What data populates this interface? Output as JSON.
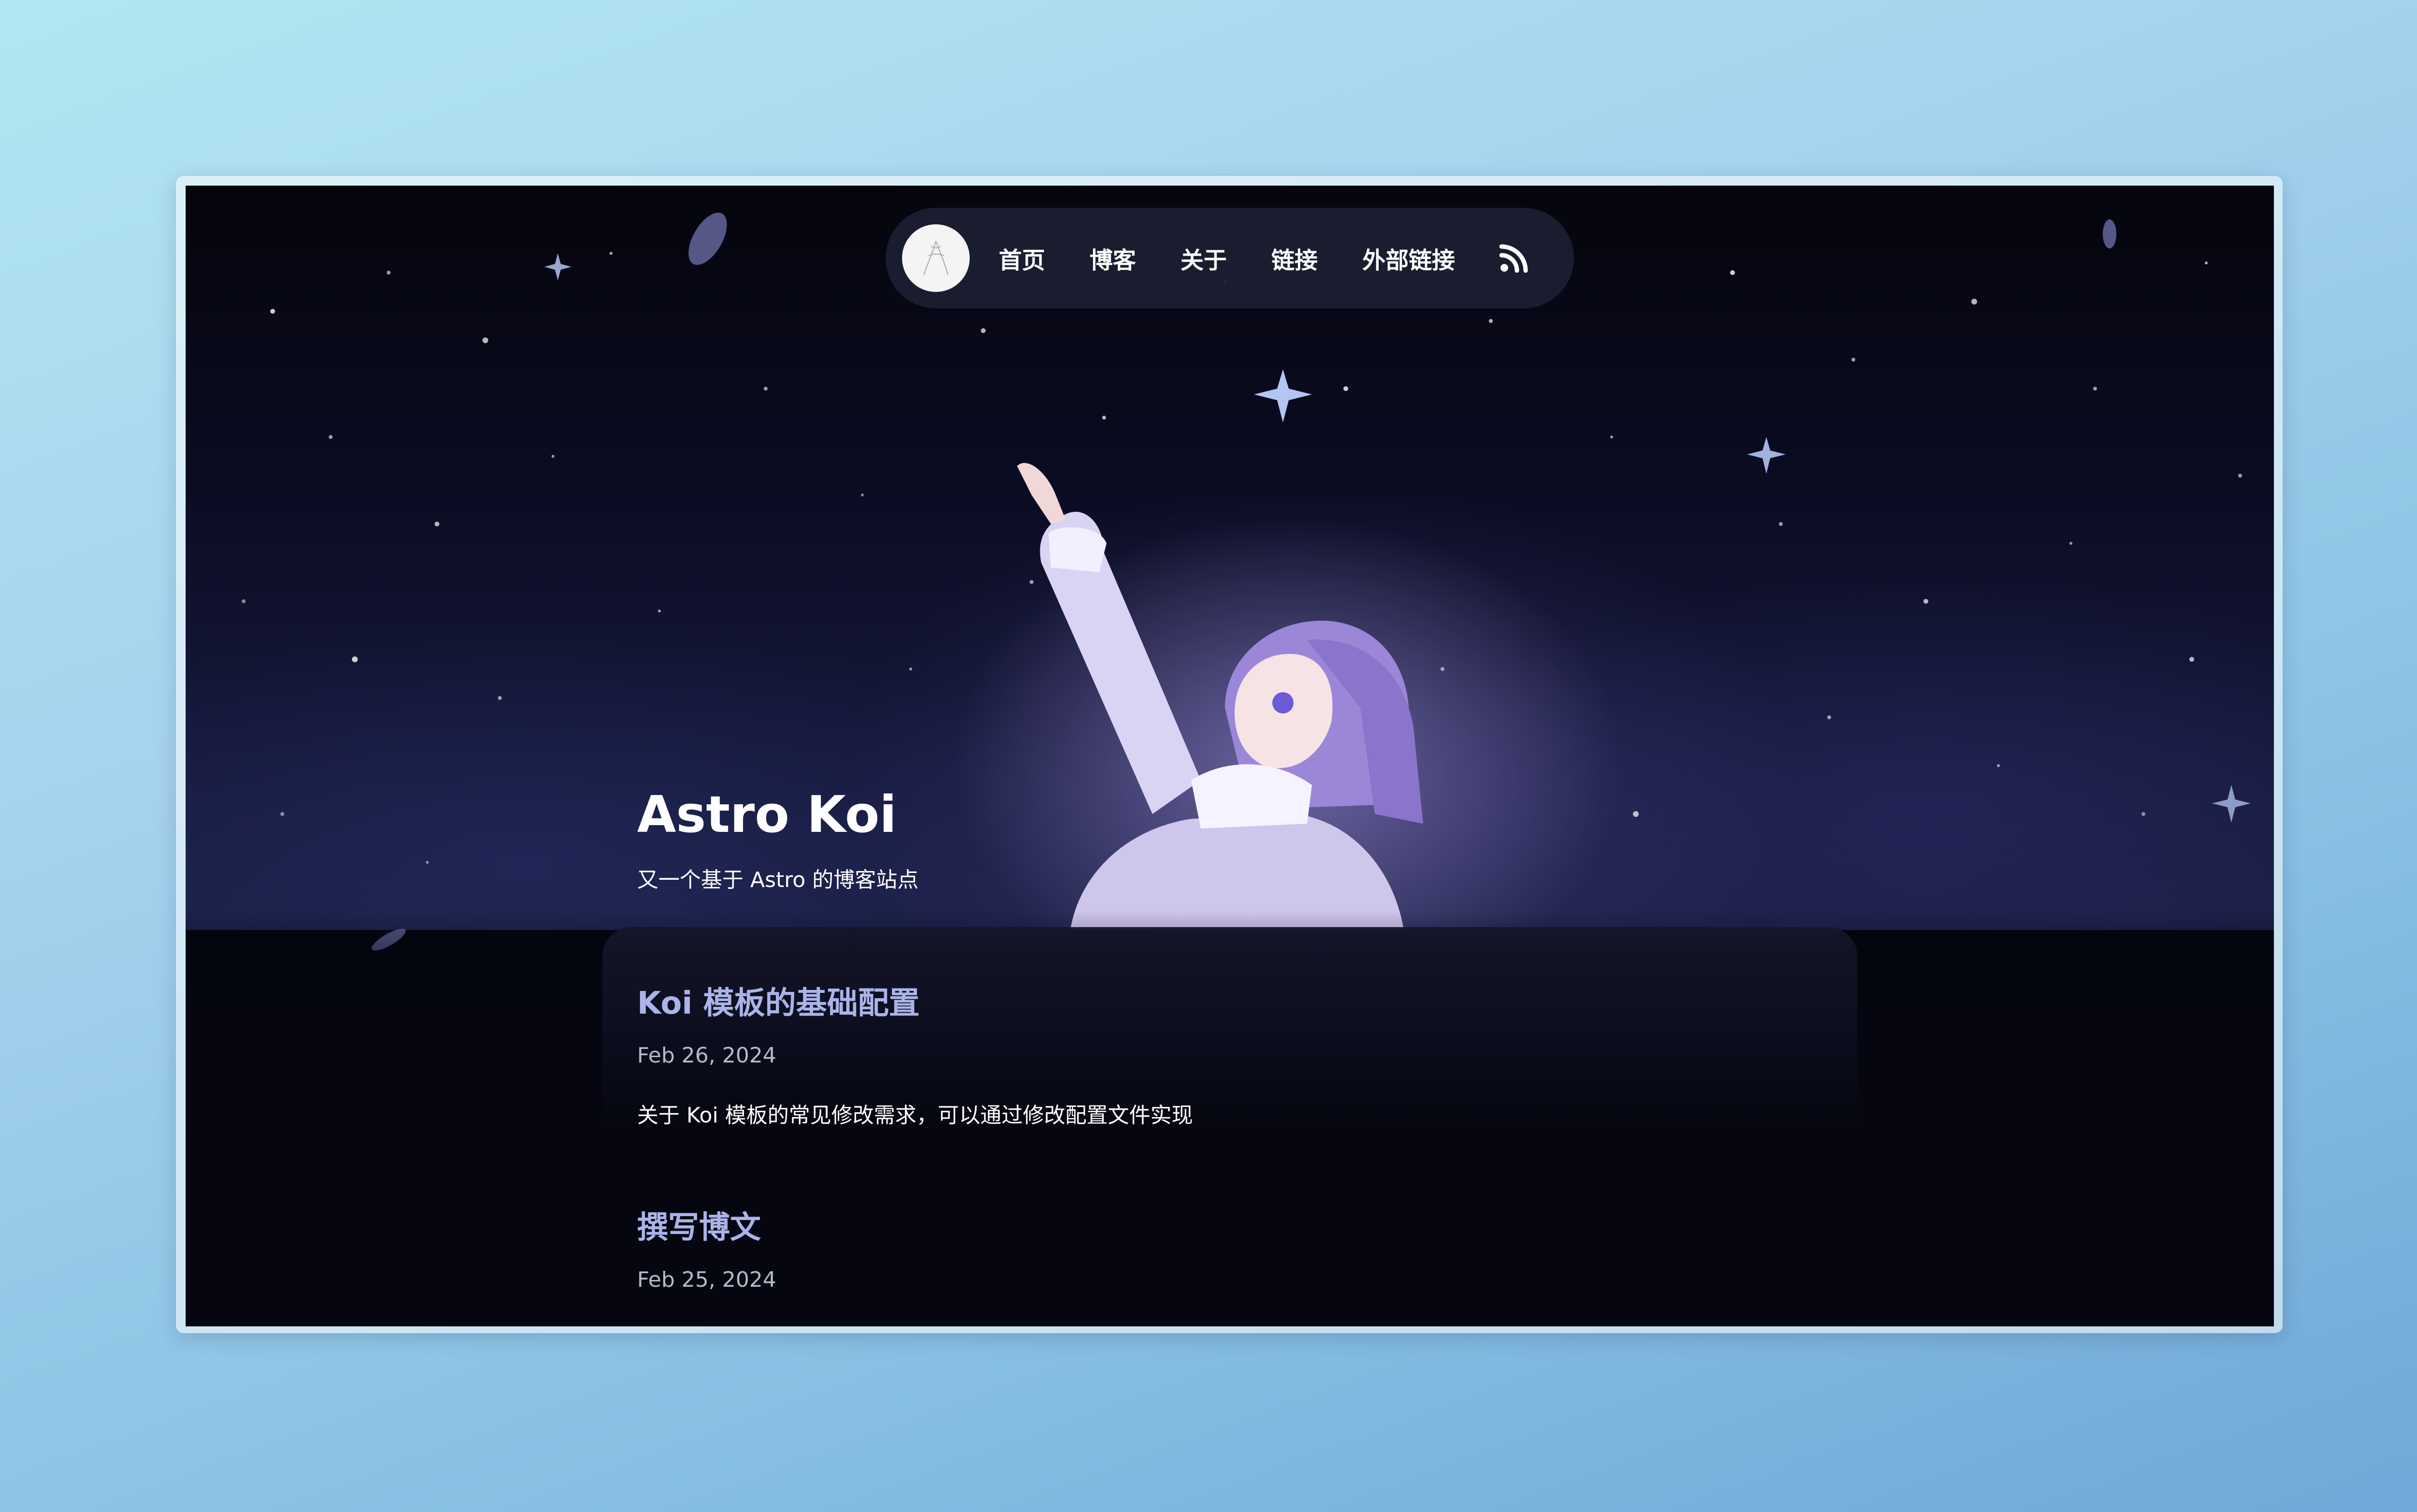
{
  "nav": {
    "items": [
      {
        "label": "首页"
      },
      {
        "label": "博客"
      },
      {
        "label": "关于"
      },
      {
        "label": "链接"
      },
      {
        "label": "外部链接"
      }
    ],
    "rss_icon": "rss-icon",
    "avatar_icon": "avatar"
  },
  "site": {
    "title": "Astro Koi",
    "subtitle": "又一个基于 Astro 的博客站点"
  },
  "posts": [
    {
      "title": "Koi 模板的基础配置",
      "date": "Feb 26, 2024",
      "description": "关于 Koi 模板的常见修改需求，可以通过修改配置文件实现"
    },
    {
      "title": "撰写博文",
      "date": "Feb 25, 2024",
      "description": ""
    }
  ],
  "colors": {
    "post_title": "#aab4e8",
    "nav_bg": "#1c1e32",
    "page_bg": "#05060f"
  }
}
